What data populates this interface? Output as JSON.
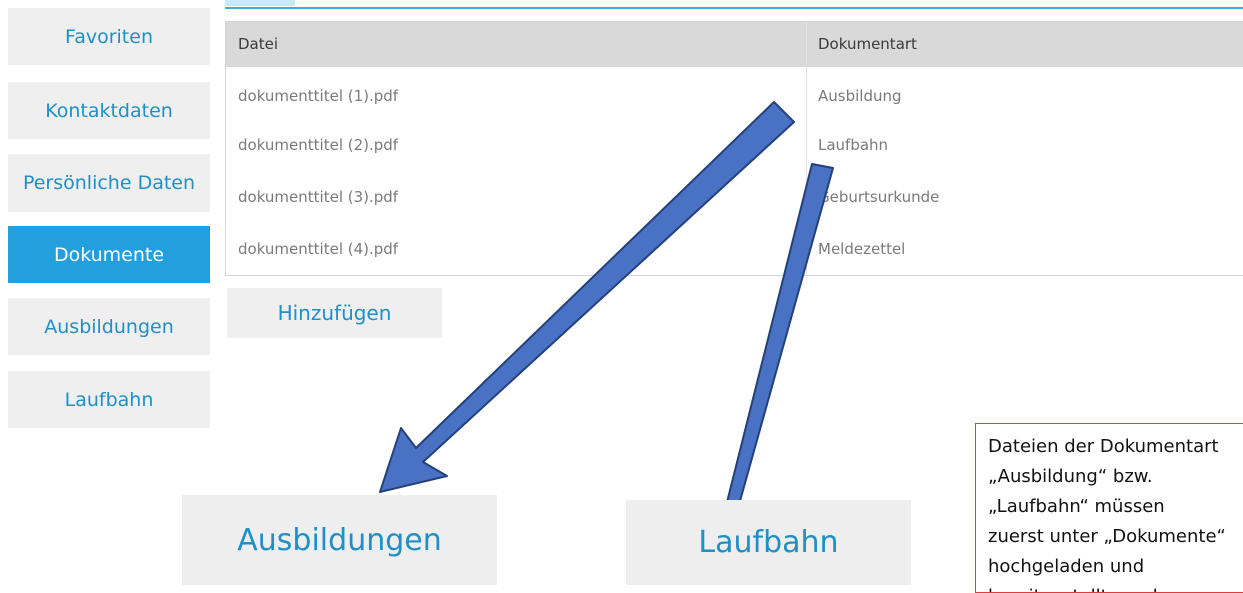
{
  "sidebar": {
    "items": [
      {
        "label": "Favoriten"
      },
      {
        "label": "Kontaktdaten"
      },
      {
        "label": "Persönliche Daten"
      },
      {
        "label": "Dokumente"
      },
      {
        "label": "Ausbildungen"
      },
      {
        "label": "Laufbahn"
      }
    ]
  },
  "table": {
    "columns": [
      "Datei",
      "Dokumentart"
    ],
    "rows": [
      {
        "file": "dokumenttitel (1).pdf",
        "type": "Ausbildung"
      },
      {
        "file": "dokumenttitel (2).pdf",
        "type": "Laufbahn"
      },
      {
        "file": "dokumenttitel (3).pdf",
        "type": "Geburtsurkunde"
      },
      {
        "file": "dokumenttitel (4).pdf",
        "type": "Meldezettel"
      }
    ]
  },
  "add_button": {
    "label": "Hinzufügen"
  },
  "zoom_buttons": {
    "left": "Ausbildungen",
    "right": "Laufbahn"
  },
  "note": {
    "text": "Dateien der Dokumentart\n„Ausbildung“ bzw. „Laufbahn“ müssen\nzuerst unter „Dokumente“\nhochgeladen und bereitgestellt werden"
  },
  "colors": {
    "accent": "#22a0de",
    "link": "#1f8fc7",
    "arrow": "#4a72c4",
    "note_border": "#e23b3b"
  }
}
